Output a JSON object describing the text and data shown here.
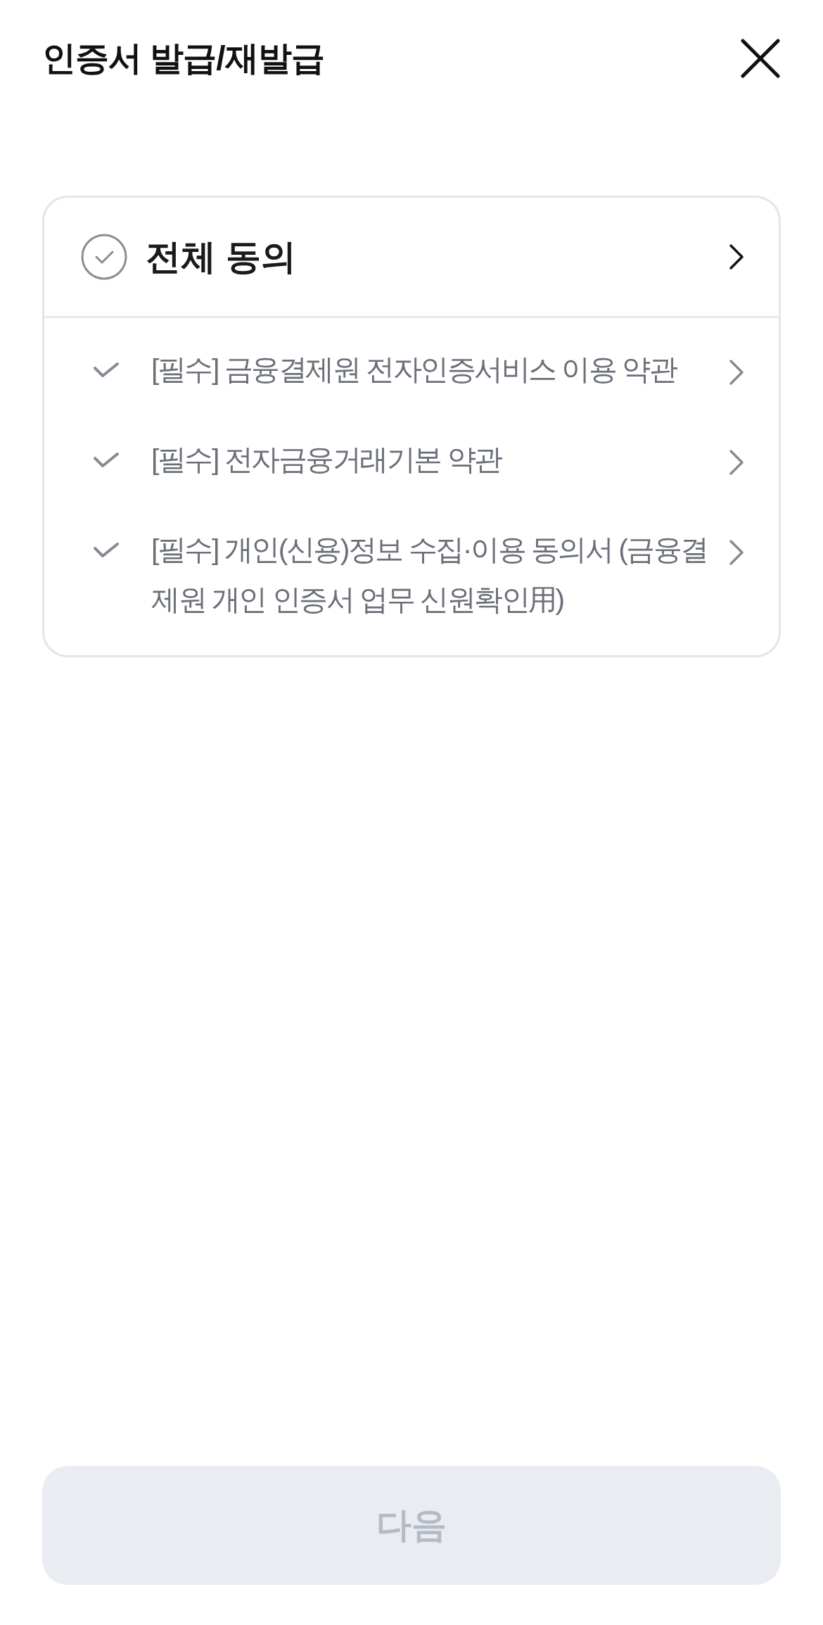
{
  "header": {
    "title": "인증서 발급/재발급"
  },
  "agreement": {
    "all": {
      "label": "전체 동의",
      "checked": false
    },
    "items": [
      {
        "label": "[필수] 금융결제원 전자인증서비스 이용 약관",
        "checked": false
      },
      {
        "label": "[필수] 전자금융거래기본 약관",
        "checked": false
      },
      {
        "label": "[필수] 개인(신용)정보 수집·이용 동의서 (금융결제원 개인 인증서 업무 신원확인用)",
        "checked": false
      }
    ]
  },
  "next_button": {
    "label": "다음",
    "disabled": true
  }
}
